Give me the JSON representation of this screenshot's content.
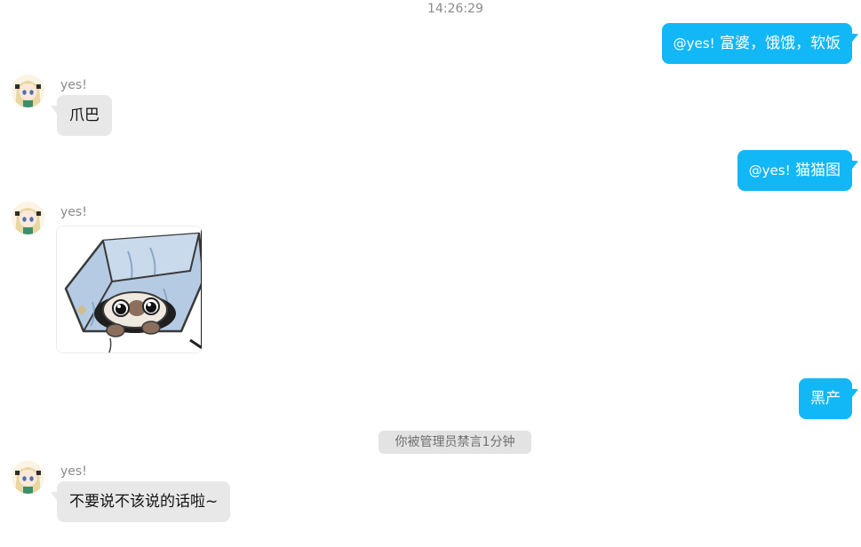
{
  "timestamp": "14:26:29",
  "colors": {
    "outgoing_bubble": "#12b7f5",
    "incoming_bubble": "#e8e8e8"
  },
  "messages": {
    "out1": {
      "mention": "@yes!",
      "text": "富婆，饿饿，软饭"
    },
    "in1": {
      "sender": "yes!",
      "text": "爪巴"
    },
    "out2": {
      "mention": "@yes!",
      "text": "猫猫图"
    },
    "in2": {
      "sender": "yes!",
      "image": "cat-in-paper-bag-sticker"
    },
    "out3": {
      "text": "黑产"
    },
    "in3": {
      "sender": "yes!",
      "text": "不要说不该说的话啦~"
    }
  },
  "system_notice": "你被管理员禁言1分钟"
}
